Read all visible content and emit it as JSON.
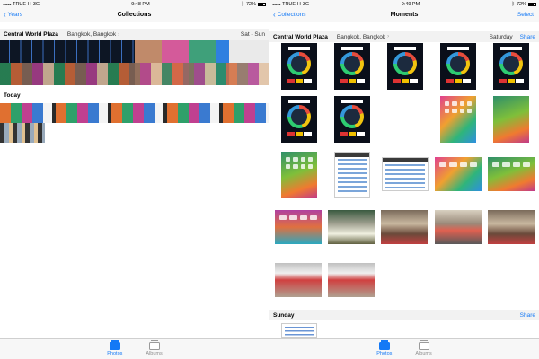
{
  "left": {
    "status": {
      "carrier": "TRUE-H",
      "network": "3G",
      "time": "9:48 PM",
      "battery": "72%",
      "battery_level": 0.72
    },
    "nav": {
      "back_label": "Years",
      "title": "Collections"
    },
    "sections": [
      {
        "title": "Central World Plaza",
        "location": "Bangkok, Bangkok",
        "date": "Sat - Sun"
      },
      {
        "title": "Today",
        "location": "",
        "date": ""
      }
    ]
  },
  "right": {
    "status": {
      "carrier": "TRUE-H",
      "network": "3G",
      "time": "9:49 PM",
      "battery": "72%",
      "battery_level": 0.72
    },
    "nav": {
      "back_label": "Collections",
      "title": "Moments",
      "action_label": "Select"
    },
    "sections": [
      {
        "title": "Central World Plaza",
        "location": "Bangkok, Bangkok",
        "date": "Saturday",
        "share_label": "Share"
      },
      {
        "title": "Sunday",
        "share_label": "Share"
      }
    ]
  },
  "tabbar": {
    "photos_label": "Photos",
    "albums_label": "Albums"
  },
  "colors": {
    "accent": "#1479f6"
  },
  "icons": {
    "back": "chevron-left-icon",
    "location": "chevron-right-icon",
    "photos_tab": "photos-tab-icon",
    "albums_tab": "albums-tab-icon"
  }
}
